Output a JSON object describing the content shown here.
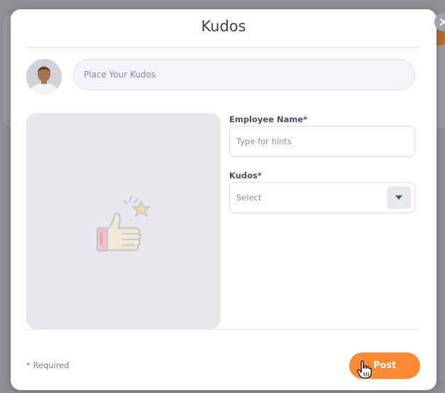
{
  "modal": {
    "title": "Kudos",
    "close_icon": "close-icon"
  },
  "composer": {
    "placeholder": "Place Your Kudos",
    "avatar_icon": "user-avatar"
  },
  "image_panel": {
    "icon": "thumbs-up-star-icon"
  },
  "form": {
    "employee_label": "Employee Name*",
    "employee_placeholder": "Type for hints",
    "kudos_label": "Kudos*",
    "kudos_selected": "Select",
    "dropdown_icon": "chevron-down-icon"
  },
  "footer": {
    "required_note": "* Required",
    "post_label": "Post"
  },
  "colors": {
    "accent": "#fb8a34",
    "title": "#3b4254",
    "overlay": "#8f8f95"
  }
}
